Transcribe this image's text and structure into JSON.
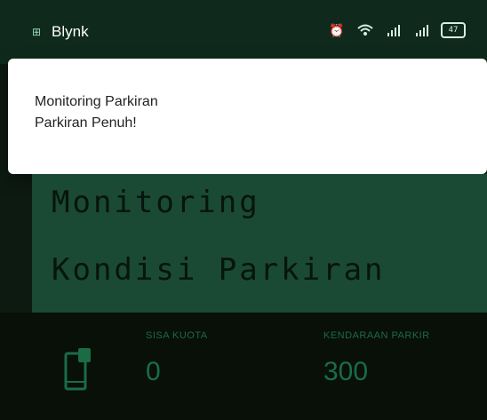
{
  "statusbar": {
    "app_name": "Blynk",
    "battery_text": "47",
    "icons": [
      "alarm-icon",
      "wifi-icon",
      "signal-icon",
      "signal-icon",
      "battery-icon"
    ]
  },
  "notification": {
    "title": "Monitoring Parkiran",
    "message": "Parkiran Penuh!"
  },
  "lcd": {
    "line1": "Monitoring",
    "line2": "Kondisi Parkiran"
  },
  "widgets": {
    "quota_label": "SISA KUOTA",
    "quota_value": "0",
    "parked_label": "KENDARAAN PARKIR",
    "parked_value": "300"
  },
  "colors": {
    "background": "#0c1a12",
    "lcd_bg": "#1a4a33",
    "accent_green": "#1a6c45"
  }
}
